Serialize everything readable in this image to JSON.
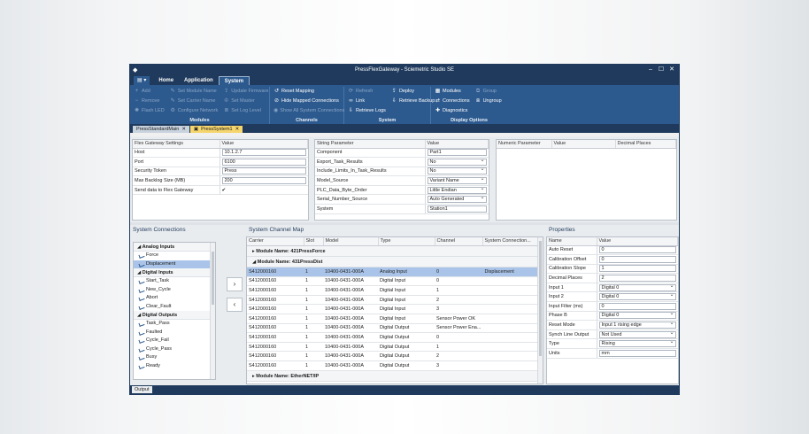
{
  "window": {
    "title": "PressFlexGateway - Sciemetric Studio SE",
    "app_icon": "diamond-icon",
    "controls": [
      "–",
      "☐",
      "✕"
    ]
  },
  "menu": {
    "file_label": "▤ ▾",
    "tabs": [
      "Home",
      "Application",
      "System"
    ]
  },
  "ribbon": {
    "modules_group": {
      "label": "Modules",
      "col1": [
        "Add",
        "Remove",
        "Flash LED"
      ],
      "col2": [
        "Set Module Name",
        "Set Carrier Name",
        "Configure Network"
      ],
      "col3": [
        "Update Firmware",
        "Set Master",
        "Set Log Level"
      ]
    },
    "channels_group": {
      "label": "Channels",
      "items": [
        "Reset Mapping",
        "Hide Mapped Connections",
        "Show All System Connections"
      ]
    },
    "system_group": {
      "label": "System",
      "col1": [
        "Refresh",
        "Link",
        "Retrieve Logs"
      ],
      "col2": [
        "Deploy",
        "Retrieve Backup"
      ]
    },
    "display_group": {
      "label": "Display Options",
      "col1": [
        "Modules",
        "Connections",
        "Diagnostics"
      ],
      "col2": [
        "Group",
        "Ungroup"
      ]
    }
  },
  "doc_tabs": [
    {
      "label": "PressStandardMain"
    },
    {
      "label": "PressSystem1"
    }
  ],
  "settings_table": {
    "headers": [
      "Flex Gateway Settings",
      "Value"
    ],
    "rows": [
      {
        "name": "Host",
        "value": "10.1.2.7"
      },
      {
        "name": "Port",
        "value": "6100"
      },
      {
        "name": "Security Token",
        "value": "Press"
      },
      {
        "name": "Max Backlog Size (MB)",
        "value": "200"
      },
      {
        "name": "Send data to Flex Gateway",
        "value": "✔"
      }
    ]
  },
  "string_table": {
    "headers": [
      "String Parameter",
      "Value"
    ],
    "rows": [
      {
        "name": "Component",
        "value": "Part1"
      },
      {
        "name": "Export_Task_Results",
        "value": "No"
      },
      {
        "name": "Include_Limits_In_Task_Results",
        "value": "No"
      },
      {
        "name": "Model_Source",
        "value": "Variant Name"
      },
      {
        "name": "PLC_Data_Byte_Order",
        "value": "Little Endian"
      },
      {
        "name": "Serial_Number_Source",
        "value": "Auto Generated"
      },
      {
        "name": "System",
        "value": "Station1"
      }
    ]
  },
  "numeric_table": {
    "headers": [
      "Numeric Parameter",
      "Value",
      "Decimal Places"
    ]
  },
  "system_connections": {
    "title": "System Connections",
    "groups": [
      {
        "label": "Analog Inputs",
        "items": [
          "Force",
          "Displacement"
        ]
      },
      {
        "label": "Digital Inputs",
        "items": [
          "Start_Task",
          "New_Cycle",
          "Abort",
          "Clear_Fault"
        ]
      },
      {
        "label": "Digital Outputs",
        "items": [
          "Task_Pass",
          "Faulted",
          "Cycle_Fail",
          "Cycle_Pass",
          "Busy",
          "Ready"
        ]
      }
    ]
  },
  "channel_map": {
    "title": "System Channel Map",
    "headers": [
      "Carrier",
      "Slot",
      "Model",
      "Type",
      "Channel",
      "System Connection..."
    ],
    "modules": [
      "Module Name: 421PressForce",
      "Module Name: 431PressDist",
      "Module Name: EtherNET/IP"
    ],
    "rows": [
      [
        "S412000160",
        "1",
        "10400-0431-000A",
        "Analog Input",
        "0",
        "Displacement"
      ],
      [
        "S412000160",
        "1",
        "10400-0431-000A",
        "Digital Input",
        "0",
        ""
      ],
      [
        "S412000160",
        "1",
        "10400-0431-000A",
        "Digital Input",
        "1",
        ""
      ],
      [
        "S412000160",
        "1",
        "10400-0431-000A",
        "Digital Input",
        "2",
        ""
      ],
      [
        "S412000160",
        "1",
        "10400-0431-000A",
        "Digital Input",
        "3",
        ""
      ],
      [
        "S412000160",
        "1",
        "10400-0431-000A",
        "Digital Input",
        "Sensor Power OK",
        ""
      ],
      [
        "S412000160",
        "1",
        "10400-0431-000A",
        "Digital Output",
        "Sensor Power Ena...",
        ""
      ],
      [
        "S412000160",
        "1",
        "10400-0431-000A",
        "Digital Output",
        "0",
        ""
      ],
      [
        "S412000160",
        "1",
        "10400-0431-000A",
        "Digital Output",
        "1",
        ""
      ],
      [
        "S412000160",
        "1",
        "10400-0431-000A",
        "Digital Output",
        "2",
        ""
      ],
      [
        "S412000160",
        "1",
        "10400-0431-000A",
        "Digital Output",
        "3",
        ""
      ]
    ]
  },
  "properties": {
    "title": "Properties",
    "headers": [
      "Name",
      "Value"
    ],
    "rows": [
      {
        "name": "Auto Reset",
        "value": "0"
      },
      {
        "name": "Calibration Offset",
        "value": "0"
      },
      {
        "name": "Calibration Slope",
        "value": "1"
      },
      {
        "name": "Decimal Places",
        "value": "2"
      },
      {
        "name": "Input 1",
        "value": "Digital 0"
      },
      {
        "name": "Input 2",
        "value": "Digital 0"
      },
      {
        "name": "Input Filter (ms)",
        "value": "0"
      },
      {
        "name": "Phase B",
        "value": "Digital 0"
      },
      {
        "name": "Reset Mode",
        "value": "Input 1 rising edge"
      },
      {
        "name": "Synch Line Output",
        "value": "Not Used"
      },
      {
        "name": "Type",
        "value": "Rising"
      },
      {
        "name": "Units",
        "value": "mm"
      }
    ]
  },
  "status": {
    "output_label": "Output"
  },
  "colors": {
    "accent": "#1f3a5c",
    "ribbon": "#2d5a8e",
    "selection": "#a9c4e8",
    "active_tab": "#f5d56d"
  }
}
